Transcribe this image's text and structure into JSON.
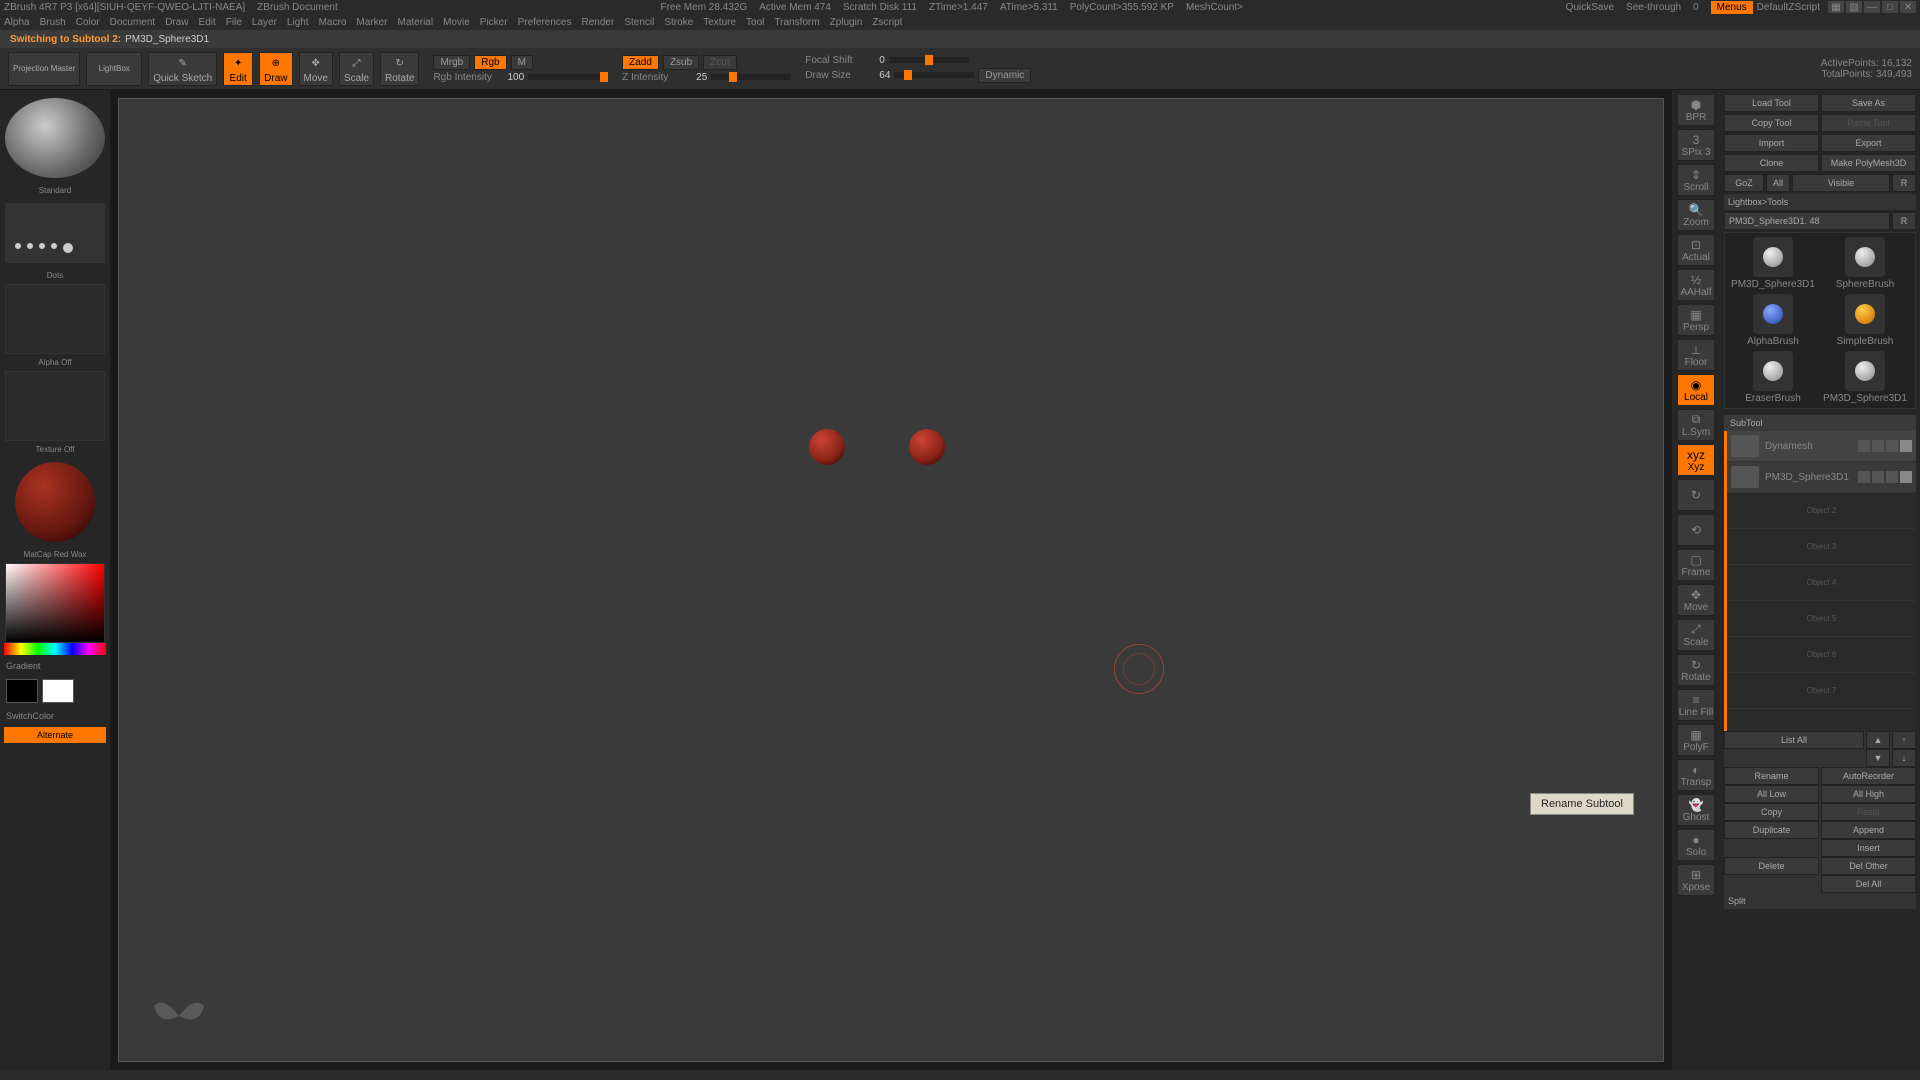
{
  "title_bar": {
    "app": "ZBrush 4R7 P3 [x64][SIUH-QEYF-QWEO-LJTI-NAEA]",
    "doc": "ZBrush Document",
    "free_mem": "Free Mem 28.432G",
    "active_mem": "Active Mem 474",
    "scratch": "Scratch Disk 111",
    "ztime": "ZTime>1.447",
    "atime": "ATime>5.311",
    "polycount": "PolyCount>355.592 KP",
    "meshcount": "MeshCount>",
    "quicksave": "QuickSave",
    "seethrough": "See-through",
    "seethrough_val": "0",
    "menus": "Menus",
    "script": "DefaultZScript"
  },
  "menus": [
    "Alpha",
    "Brush",
    "Color",
    "Document",
    "Draw",
    "Edit",
    "File",
    "Layer",
    "Light",
    "Macro",
    "Marker",
    "Material",
    "Movie",
    "Picker",
    "Preferences",
    "Render",
    "Stencil",
    "Stroke",
    "Texture",
    "Tool",
    "Transform",
    "Zplugin",
    "Zscript"
  ],
  "status": {
    "text": "Switching to Subtool 2:",
    "name": "PM3D_Sphere3D1"
  },
  "shelf": {
    "projection": "Projection Master",
    "lightbox": "LightBox",
    "quicksketch": "Quick Sketch",
    "edit": "Edit",
    "draw": "Draw",
    "move": "Move",
    "scale": "Scale",
    "rotate": "Rotate",
    "mrgb": "Mrgb",
    "rgb": "Rgb",
    "m": "M",
    "rgb_intensity_lbl": "Rgb Intensity",
    "rgb_intensity": "100",
    "zadd": "Zadd",
    "zsub": "Zsub",
    "zcut": "Zcut",
    "z_intensity_lbl": "Z Intensity",
    "z_intensity": "25",
    "focal_lbl": "Focal Shift",
    "focal": "0",
    "draw_size_lbl": "Draw Size",
    "draw_size": "64",
    "dynamic": "Dynamic",
    "active_pts_lbl": "ActivePoints:",
    "active_pts": "16,132",
    "total_pts_lbl": "TotalPoints:",
    "total_pts": "349,493"
  },
  "left": {
    "brush": "Standard",
    "stroke": "Dots",
    "alpha": "Alpha Off",
    "texture": "Texture Off",
    "material": "MatCap Red Wax",
    "gradient": "Gradient",
    "switchcolor": "SwitchColor",
    "alternate": "Alternate"
  },
  "right_shelf": [
    "BPR",
    "SPix 3",
    "Scroll",
    "Zoom",
    "Actual",
    "AAHalf",
    "Persp",
    "Floor",
    "Local",
    "L.Sym",
    "Xyz",
    "",
    "",
    "Frame",
    "Move",
    "Scale",
    "Rotate",
    "Line Fill",
    "PolyF",
    "Transp",
    "Ghost",
    "Solo",
    "Xpose"
  ],
  "rp": {
    "load": "Load Tool",
    "saveas": "Save As",
    "copy": "Copy Tool",
    "paste": "Paste Tool",
    "import": "Import",
    "export": "Export",
    "clone": "Clone",
    "makepoly": "Make PolyMesh3D",
    "goz": "GoZ",
    "all": "All",
    "visible": "Visible",
    "r": "R",
    "lightbox_tools": "Lightbox>Tools",
    "current": "PM3D_Sphere3D1. 48",
    "tools": [
      "PM3D_Sphere3D1",
      "SphereBrush",
      "AlphaBrush",
      "SimpleBrush",
      "EraserBrush",
      "PM3D_Sphere3D1"
    ],
    "subtool_hdr": "SubTool",
    "st1": "Dynamesh",
    "st2": "PM3D_Sphere3D1",
    "st_empty": [
      "Object 2",
      "Object 3",
      "Object 4",
      "Object 5",
      "Object 6",
      "Object 7"
    ],
    "listall": "List All",
    "rename": "Rename",
    "autoreorder": "AutoReorder",
    "alllow": "All Low",
    "allhigh": "All High",
    "copy2": "Copy",
    "paste2": "Paste",
    "duplicate": "Duplicate",
    "append": "Append",
    "insert": "Insert",
    "delete": "Delete",
    "delother": "Del Other",
    "delall": "Del All",
    "split": "Split"
  },
  "tooltip": "Rename Subtool"
}
